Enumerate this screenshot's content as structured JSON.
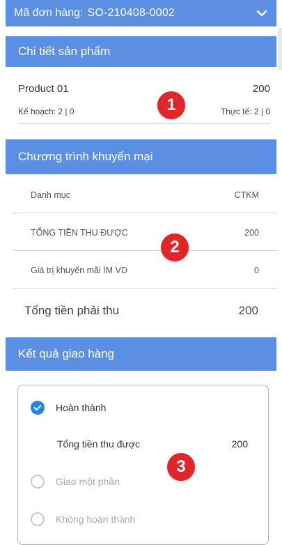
{
  "order": {
    "label": "Mã đơn hàng:",
    "code": "SO-210408-0002"
  },
  "sections": {
    "product_details": "Chi tiết sản phẩm",
    "promotion": "Chương trình khuyến mại",
    "delivery_result": "Kết quả giao hàng"
  },
  "product": {
    "name": "Product 01",
    "quantity": "200",
    "plan": "Kế hoạch: 2 | 0",
    "actual": "Thực tế: 2 | 0"
  },
  "promotion_table": [
    {
      "label": "Danh mục",
      "value": "CTKM"
    },
    {
      "label": "TỔNG TIỀN THU ĐƯỢC",
      "value": "200"
    },
    {
      "label": "Giá trị khuyến mãi IM VD",
      "value": "0"
    }
  ],
  "total_due": {
    "label": "Tổng tiền phải thu",
    "value": "200"
  },
  "delivery": {
    "options": [
      {
        "label": "Hoàn thành",
        "checked": true
      },
      {
        "label": "Giao một phần",
        "checked": false
      },
      {
        "label": "Không hoàn thành",
        "checked": false
      }
    ],
    "collected_label": "Tổng tiền thu được",
    "collected_value": "200"
  },
  "markers": [
    "1",
    "2",
    "3"
  ],
  "colors": {
    "header": "#5b8fe3",
    "check": "#1f88dc",
    "marker": "#e1262a"
  }
}
